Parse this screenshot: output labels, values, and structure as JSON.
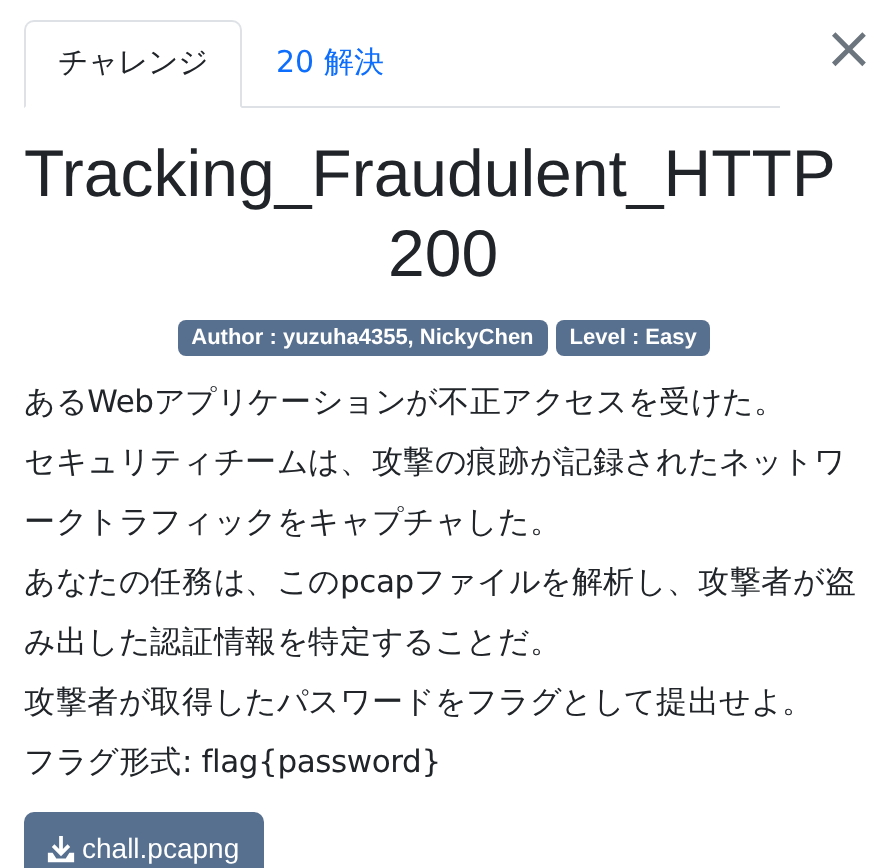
{
  "tabs": [
    {
      "label": "チャレンジ",
      "selected": true
    },
    {
      "label": "20 解決",
      "selected": false
    }
  ],
  "close_label": "×",
  "title": "Tracking_Fraudulent_HTTP",
  "value": "200",
  "tags": [
    "Author : yuzuha4355, NickyChen",
    "Level : Easy"
  ],
  "description": [
    "あるWebアプリケーションが不正アクセスを受けた。",
    "セキュリティチームは、攻撃の痕跡が記録されたネットワークトラフィックをキャプチャした。",
    "あなたの任務は、このpcapファイルを解析し、攻撃者が盗み出した認証情報を特定することだ。",
    "攻撃者が取得したパスワードをフラグとして提出せよ。",
    "フラグ形式: flag{password}"
  ],
  "files": [
    "chall.pcapng"
  ]
}
